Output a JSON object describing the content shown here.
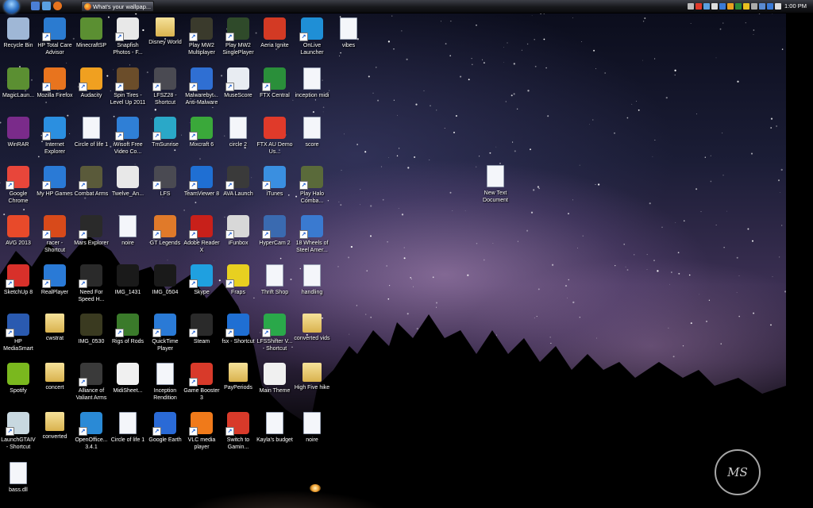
{
  "taskbar": {
    "start_icon": "windows-orb-icon",
    "quick_launch": [
      {
        "icon": "show-desktop-icon",
        "color": "#4b7fd6"
      },
      {
        "icon": "switch-windows-icon",
        "color": "#5aa0e0"
      },
      {
        "icon": "firefox-icon",
        "color": "#e8741e"
      }
    ],
    "active_window": {
      "label": "What's your wallpap...",
      "icon": "firefox-icon"
    },
    "tray_icons": [
      "chevron-left-icon",
      "antivirus-icon",
      "network-icon",
      "cloud-icon",
      "shield-icon",
      "chat-icon",
      "security-icon",
      "warning-icon",
      "power-icon",
      "display-icon",
      "bluetooth-icon",
      "volume-icon"
    ],
    "clock": "1:00 PM"
  },
  "wallpaper": {
    "watermark": "MS"
  },
  "desktop_icons": [
    {
      "label": "Recycle Bin",
      "icon": "recycle-bin-icon",
      "color": "#9fb7d6",
      "shortcut": false
    },
    {
      "label": "HP Total Care Advisor",
      "icon": "hp-care-icon",
      "color": "#2b7bd0",
      "shortcut": true
    },
    {
      "label": "MinecraftSP",
      "icon": "minecraft-icon",
      "color": "#5b8f32",
      "shortcut": false
    },
    {
      "label": "Snapfish Photos - F...",
      "icon": "snapfish-icon",
      "color": "#e8e8e8",
      "shortcut": true
    },
    {
      "label": "Disney World",
      "icon": "folder-icon",
      "color": "#e3c466",
      "shortcut": false
    },
    {
      "label": "Play MW2 Multiplayer",
      "icon": "mw2-icon",
      "color": "#3a3a2c",
      "shortcut": true
    },
    {
      "label": "Play MW2 SinglePlayer",
      "icon": "mw2-icon",
      "color": "#2f4a2a",
      "shortcut": true
    },
    {
      "label": "Aeria Ignite",
      "icon": "aeria-icon",
      "color": "#d33a24",
      "shortcut": false
    },
    {
      "label": "OnLive Launcher",
      "icon": "onlive-icon",
      "color": "#1f8fd6",
      "shortcut": true
    },
    {
      "label": "vibes",
      "icon": "document-icon",
      "color": "#ffffff",
      "shortcut": false
    },
    {
      "label": "MagicLaun...",
      "icon": "magiclauncher-icon",
      "color": "#5b8f32",
      "shortcut": false
    },
    {
      "label": "Mozilla Firefox",
      "icon": "firefox-icon",
      "color": "#e8741e",
      "shortcut": true
    },
    {
      "label": "Audacity",
      "icon": "audacity-icon",
      "color": "#f0a020",
      "shortcut": true
    },
    {
      "label": "Spin Tires - Level Up 2011",
      "icon": "spintires-icon",
      "color": "#6b4d2a",
      "shortcut": true
    },
    {
      "label": "LFSZ28 - Shortcut",
      "icon": "lfs-icon",
      "color": "#4a4a52",
      "shortcut": true
    },
    {
      "label": "Malwarebyt... Anti-Malware",
      "icon": "malwarebytes-icon",
      "color": "#2f6fd3",
      "shortcut": true
    },
    {
      "label": "MuseScore",
      "icon": "musescore-icon",
      "color": "#e8ecf2",
      "shortcut": true
    },
    {
      "label": "FTX Central",
      "icon": "ftx-icon",
      "color": "#2a8f3a",
      "shortcut": true
    },
    {
      "label": "inception midi",
      "icon": "media-file-icon",
      "color": "#ffffff",
      "shortcut": false
    },
    {
      "label": "WinRAR",
      "icon": "winrar-icon",
      "color": "#7a2b8a",
      "shortcut": false
    },
    {
      "label": "Internet Explorer",
      "icon": "internet-explorer-icon",
      "color": "#2b8fe0",
      "shortcut": true
    },
    {
      "label": "Circle of life 1",
      "icon": "document-icon",
      "color": "#ffffff",
      "shortcut": false
    },
    {
      "label": "iWisoft Free Video Co...",
      "icon": "iwisoft-icon",
      "color": "#2f7fd6",
      "shortcut": true
    },
    {
      "label": "TmSunrise",
      "icon": "trackmania-icon",
      "color": "#2aa8c8",
      "shortcut": true
    },
    {
      "label": "Mixcraft 6",
      "icon": "mixcraft-icon",
      "color": "#3aa83a",
      "shortcut": true
    },
    {
      "label": "circle 2",
      "icon": "media-file-icon",
      "color": "#ffffff",
      "shortcut": false
    },
    {
      "label": "FTX AU Demo Us...",
      "icon": "pdf-icon",
      "color": "#e03a2a",
      "shortcut": false
    },
    {
      "label": "score",
      "icon": "media-file-icon",
      "color": "#ffffff",
      "shortcut": false
    },
    {
      "label": "Google Chrome",
      "icon": "chrome-icon",
      "color": "#e8463a",
      "shortcut": true
    },
    {
      "label": "My HP Games",
      "icon": "hp-games-icon",
      "color": "#2a7ad6",
      "shortcut": true
    },
    {
      "label": "Combat Arms",
      "icon": "combat-arms-icon",
      "color": "#5a5a3a",
      "shortcut": true
    },
    {
      "label": "Twelve_An...",
      "icon": "pdf-icon",
      "color": "#e8e8e8",
      "shortcut": false
    },
    {
      "label": "LFS",
      "icon": "lfs-icon",
      "color": "#4a4a52",
      "shortcut": true
    },
    {
      "label": "TeamViewer 8",
      "icon": "teamviewer-icon",
      "color": "#1f6fd3",
      "shortcut": true
    },
    {
      "label": "AVA Launch",
      "icon": "ava-icon",
      "color": "#3a3a3a",
      "shortcut": true
    },
    {
      "label": "iTunes",
      "icon": "itunes-icon",
      "color": "#3a8fe0",
      "shortcut": true
    },
    {
      "label": "Play Halo Comba...",
      "icon": "halo-icon",
      "color": "#5a6a3a",
      "shortcut": true
    },
    {
      "label": "AVG 2013",
      "icon": "avg-icon",
      "color": "#e84a2a",
      "shortcut": false
    },
    {
      "label": "racer - Shortcut",
      "icon": "racer-icon",
      "color": "#d84a1a",
      "shortcut": true
    },
    {
      "label": "Mars Explorer",
      "icon": "unity-icon",
      "color": "#2a2a2a",
      "shortcut": true
    },
    {
      "label": "noire",
      "icon": "document-icon",
      "color": "#ffffff",
      "shortcut": false
    },
    {
      "label": "GT Legends",
      "icon": "gt-legends-icon",
      "color": "#e07a2a",
      "shortcut": true
    },
    {
      "label": "Adobe Reader X",
      "icon": "adobe-reader-icon",
      "color": "#c8201a",
      "shortcut": true
    },
    {
      "label": "iFunbox",
      "icon": "ifunbox-icon",
      "color": "#d8d8d8",
      "shortcut": true
    },
    {
      "label": "HyperCam 2",
      "icon": "hypercam-icon",
      "color": "#3a6ab0",
      "shortcut": true
    },
    {
      "label": "18 Wheels of Steel Amer...",
      "icon": "truck-icon",
      "color": "#3a7ad0",
      "shortcut": true
    },
    {
      "label": "SketchUp 8",
      "icon": "sketchup-icon",
      "color": "#d8302a",
      "shortcut": true
    },
    {
      "label": "RealPlayer",
      "icon": "realplayer-icon",
      "color": "#2a7ad6",
      "shortcut": true
    },
    {
      "label": "Need For Speed H...",
      "icon": "nfs-icon",
      "color": "#2a2a2a",
      "shortcut": true
    },
    {
      "label": "IMG_1431",
      "icon": "video-file-icon",
      "color": "#1a1a1a",
      "shortcut": false
    },
    {
      "label": "IMG_0504",
      "icon": "video-file-icon",
      "color": "#1a1a1a",
      "shortcut": false
    },
    {
      "label": "Skype",
      "icon": "skype-icon",
      "color": "#1fa0e0",
      "shortcut": true
    },
    {
      "label": "Fraps",
      "icon": "fraps-icon",
      "color": "#e8d020",
      "shortcut": true
    },
    {
      "label": "Thrift Shop",
      "icon": "media-file-icon",
      "color": "#ffffff",
      "shortcut": false
    },
    {
      "label": "handling",
      "icon": "document-icon",
      "color": "#ffffff",
      "shortcut": false
    },
    {
      "label": "HP MediaSmart",
      "icon": "hp-mediasmart-icon",
      "color": "#2a5ab0",
      "shortcut": true
    },
    {
      "label": "cwstrat",
      "icon": "folder-icon",
      "color": "#e3c466",
      "shortcut": false
    },
    {
      "label": "IMG_0530",
      "icon": "video-file-icon",
      "color": "#3a3a20",
      "shortcut": false
    },
    {
      "label": "Rigs of Rods",
      "icon": "rigs-of-rods-icon",
      "color": "#3a7a2a",
      "shortcut": true
    },
    {
      "label": "QuickTime Player",
      "icon": "quicktime-icon",
      "color": "#2a7ad6",
      "shortcut": true
    },
    {
      "label": "Steam",
      "icon": "steam-icon",
      "color": "#2a2a2a",
      "shortcut": true
    },
    {
      "label": "fsx - Shortcut",
      "icon": "fsx-icon",
      "color": "#1f6fd3",
      "shortcut": true
    },
    {
      "label": "LFSShifter V... - Shortcut",
      "icon": "lfs-shifter-icon",
      "color": "#2aa84a",
      "shortcut": true
    },
    {
      "label": "converted vids",
      "icon": "folder-icon",
      "color": "#e3c466",
      "shortcut": false
    },
    {
      "label": "Spotify",
      "icon": "spotify-icon",
      "color": "#7ab81e",
      "shortcut": false
    },
    {
      "label": "concert",
      "icon": "folder-icon",
      "color": "#e3c466",
      "shortcut": false
    },
    {
      "label": "Alliance of Valiant Arms",
      "icon": "ava-icon",
      "color": "#3a3a3a",
      "shortcut": true
    },
    {
      "label": "MidiSheet...",
      "icon": "midisheet-icon",
      "color": "#f0f0f0",
      "shortcut": false
    },
    {
      "label": "Inception Rendition",
      "icon": "mp3-file-icon",
      "color": "#ffffff",
      "shortcut": false
    },
    {
      "label": "Game Booster 3",
      "icon": "game-booster-icon",
      "color": "#d83a2a",
      "shortcut": true
    },
    {
      "label": "PayPeriods",
      "icon": "folder-icon",
      "color": "#e3c466",
      "shortcut": false
    },
    {
      "label": "Main Theme",
      "icon": "midisheet-icon",
      "color": "#f0f0f0",
      "shortcut": false
    },
    {
      "label": "High Five hike",
      "icon": "folder-icon",
      "color": "#e3c466",
      "shortcut": false
    },
    {
      "label": "LaunchGTAIV - Shortcut",
      "icon": "gtaiv-icon",
      "color": "#c8d8e0",
      "shortcut": true
    },
    {
      "label": "converted",
      "icon": "folder-icon",
      "color": "#e3c466",
      "shortcut": false
    },
    {
      "label": "OpenOffice... 3.4.1",
      "icon": "openoffice-icon",
      "color": "#2a8ad6",
      "shortcut": true
    },
    {
      "label": "Circle of life 1",
      "icon": "document-icon",
      "color": "#ffffff",
      "shortcut": false
    },
    {
      "label": "Google Earth",
      "icon": "google-earth-icon",
      "color": "#2a6ad6",
      "shortcut": true
    },
    {
      "label": "VLC media player",
      "icon": "vlc-icon",
      "color": "#f07a1a",
      "shortcut": true
    },
    {
      "label": "Switch to Gamin...",
      "icon": "game-booster-icon",
      "color": "#d83a2a",
      "shortcut": true
    },
    {
      "label": "Kayla's budget",
      "icon": "document-icon",
      "color": "#ffffff",
      "shortcut": false
    },
    {
      "label": "noire",
      "icon": "document-icon",
      "color": "#ffffff",
      "shortcut": false
    },
    {
      "label": "bass.dll",
      "icon": "dll-file-icon",
      "color": "#ffffff",
      "shortcut": false
    },
    {
      "label": "New Text Document",
      "icon": "text-document-icon",
      "color": "#ffffff",
      "shortcut": false
    }
  ]
}
